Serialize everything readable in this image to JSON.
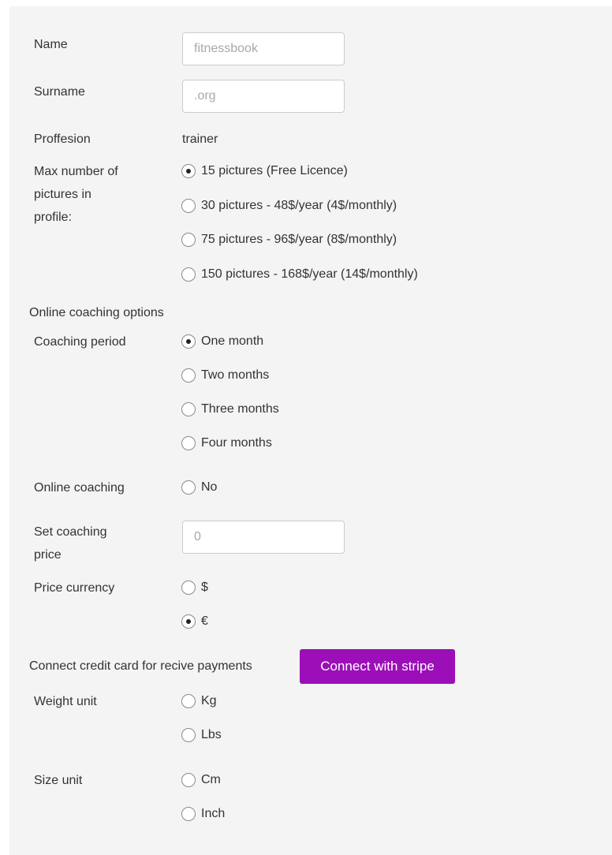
{
  "fields": {
    "name_label": "Name",
    "name_placeholder": "fitnessbook",
    "surname_label": "Surname",
    "surname_placeholder": ".org",
    "profession_label": "Proffesion",
    "profession_value": "trainer",
    "max_pictures_label_line1": "Max number of",
    "max_pictures_label_line2": "pictures in",
    "max_pictures_label_line3": "profile:",
    "pictures_options": [
      {
        "label": "15 pictures (Free Licence)",
        "selected": true
      },
      {
        "label": "30 pictures - 48$/year (4$/monthly)",
        "selected": false
      },
      {
        "label": "75 pictures - 96$/year (8$/monthly)",
        "selected": false
      },
      {
        "label": "150 pictures - 168$/year (14$/monthly)",
        "selected": false
      }
    ]
  },
  "coaching": {
    "section_title": "Online coaching options",
    "period_label": "Coaching period",
    "period_options": [
      {
        "label": "One month",
        "selected": true
      },
      {
        "label": "Two months",
        "selected": false
      },
      {
        "label": "Three months",
        "selected": false
      },
      {
        "label": "Four months",
        "selected": false
      }
    ],
    "online_label": "Online coaching",
    "online_options": [
      {
        "label": "No",
        "selected": false
      }
    ],
    "price_label_line1": "Set coaching",
    "price_label_line2": "price",
    "price_placeholder": "0",
    "currency_label": "Price currency",
    "currency_options": [
      {
        "label": "$",
        "selected": false
      },
      {
        "label": "€",
        "selected": true
      }
    ]
  },
  "payments": {
    "connect_text": "Connect credit card for recive payments",
    "stripe_button": "Connect with stripe",
    "stripe_color": "#9c0fb8"
  },
  "units": {
    "weight_label": "Weight unit",
    "weight_options": [
      {
        "label": "Kg",
        "selected": false
      },
      {
        "label": "Lbs",
        "selected": false
      }
    ],
    "size_label": "Size unit",
    "size_options": [
      {
        "label": "Cm",
        "selected": false
      },
      {
        "label": "Inch",
        "selected": false
      }
    ]
  }
}
